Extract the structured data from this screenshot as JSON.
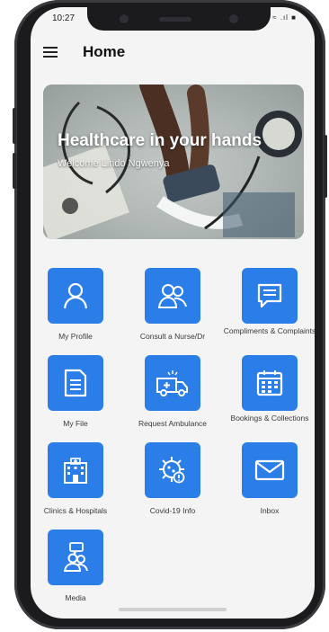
{
  "status_bar": {
    "time": "10:27",
    "icons": "N ≈ .ıl ■"
  },
  "app_bar": {
    "title": "Home"
  },
  "banner": {
    "title": "Healthcare in your hands",
    "subtitle": "Welcome Lindo Ngwenya"
  },
  "tiles": [
    {
      "label": "My Profile",
      "icon": "profile-icon"
    },
    {
      "label": "Consult a Nurse/Dr",
      "icon": "nurse-doctor-icon"
    },
    {
      "label": "Compliments & Complaints",
      "icon": "chat-bubble-icon"
    },
    {
      "label": "My File",
      "icon": "document-icon"
    },
    {
      "label": "Request Ambulance",
      "icon": "ambulance-icon"
    },
    {
      "label": "Bookings & Collections",
      "icon": "calendar-icon"
    },
    {
      "label": "Clinics & Hospitals",
      "icon": "hospital-icon"
    },
    {
      "label": "Covid-19 Info",
      "icon": "virus-icon"
    },
    {
      "label": "Inbox",
      "icon": "envelope-icon"
    },
    {
      "label": "Media",
      "icon": "media-icon"
    }
  ],
  "colors": {
    "tile": "#2b7de8",
    "screen": "#f4f4f4"
  }
}
